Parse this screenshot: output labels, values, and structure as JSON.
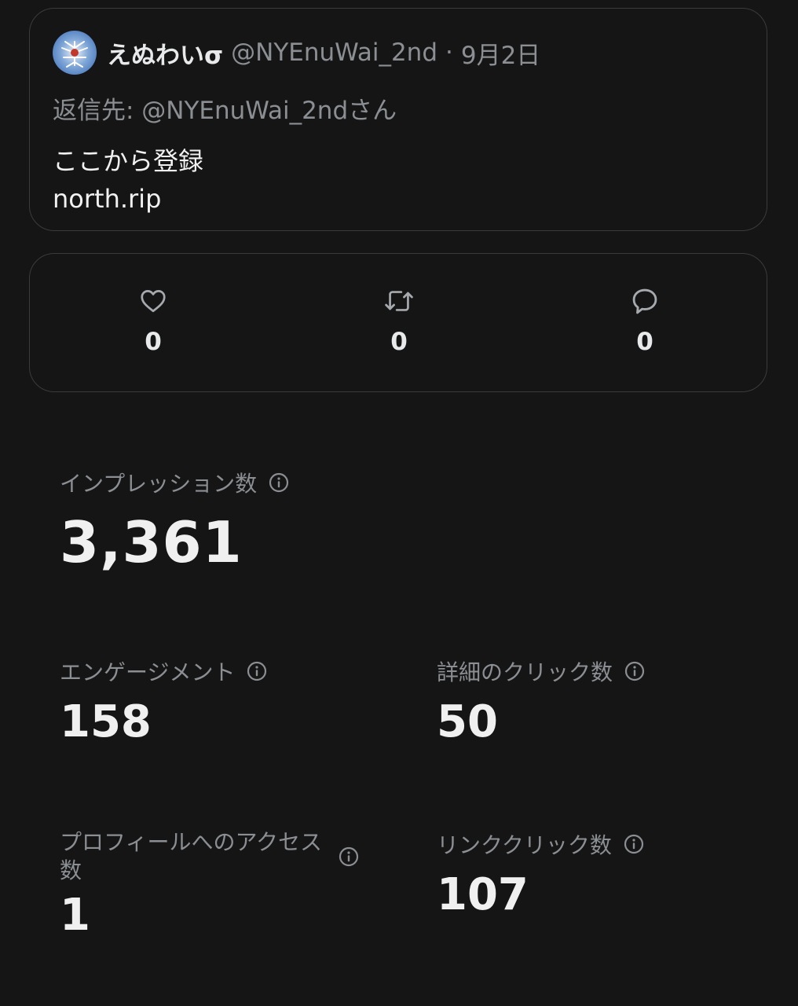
{
  "tweet": {
    "display_name": "えぬわいσ",
    "handle": "@NYEnuWai_2nd",
    "separator": "·",
    "date": "9月2日",
    "reply_to": "返信先: @NYEnuWai_2ndさん",
    "text_line1": "ここから登録",
    "text_line2": "north.rip"
  },
  "actions": [
    {
      "icon": "heart-icon",
      "count": "0"
    },
    {
      "icon": "retweet-icon",
      "count": "0"
    },
    {
      "icon": "reply-icon",
      "count": "0"
    }
  ],
  "metrics": {
    "impressions": {
      "label": "インプレッション数",
      "value": "3,361"
    },
    "engagement": {
      "label": "エンゲージメント",
      "value": "158"
    },
    "detail_clicks": {
      "label": "詳細のクリック数",
      "value": "50"
    },
    "profile_visits": {
      "label": "プロフィールへのアクセス数",
      "value": "1"
    },
    "link_clicks": {
      "label": "リンククリック数",
      "value": "107"
    }
  },
  "colors": {
    "background": "#151515",
    "border": "#3b3b3b",
    "secondary_text": "#8b8f93",
    "primary_text": "#e7e9ea"
  }
}
